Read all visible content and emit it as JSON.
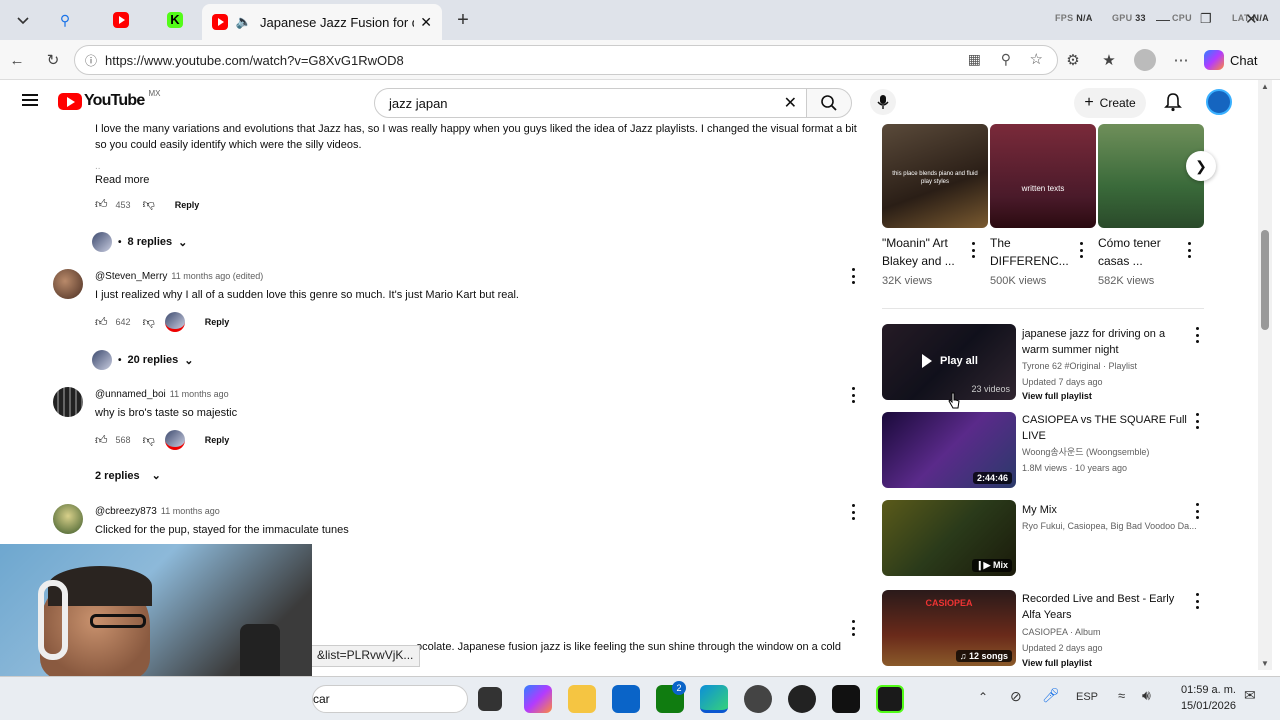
{
  "browser": {
    "active_tab_title": "Japanese Jazz Fusion for drivi",
    "url": "https://www.youtube.com/watch?v=G8XvG1RwOD8",
    "chat_label": "Chat",
    "perf": {
      "fps_label": "FPS",
      "fps_value": "N/A",
      "gpu_label": "GPU",
      "gpu_value": "33",
      "cpu_label": "CPU",
      "lat_label": "LAT",
      "lat_value": "N/A"
    }
  },
  "youtube": {
    "logo": "YouTube",
    "region": "MX",
    "search_value": "jazz japan",
    "create_label": "Create"
  },
  "comments": [
    {
      "text": "I love the many variations and evolutions that Jazz has, so I was really happy when you guys liked the idea of Jazz playlists. I changed the visual format a bit so you could easily identify which were the silly videos.",
      "read_more": "Read more",
      "likes": "453",
      "reply": "Reply",
      "replies": "8 replies"
    },
    {
      "author": "@Steven_Merry",
      "meta": "11 months ago (edited)",
      "text": "I just realized why I all of a sudden love this genre so much. It's just Mario Kart but real.",
      "likes": "642",
      "reply": "Reply",
      "replies": "20 replies"
    },
    {
      "author": "@unnamed_boi",
      "meta": "11 months ago",
      "text": "why is bro's taste so majestic",
      "likes": "568",
      "reply": "Reply",
      "replies": "2 replies"
    },
    {
      "author": "@cbreezy873",
      "meta": "11 months ago",
      "text": "Clicked for the pup, stayed for the immaculate tunes"
    },
    {
      "text": "ocolate. Japanese fusion jazz is like feeling the sun shine through the window on a cold"
    }
  ],
  "status_tooltip": "&list=PLRvwVjK...",
  "shorts": [
    {
      "title_line1": "\"Moanin\" Art",
      "title_line2": "Blakey and ...",
      "views": "32K views",
      "overlay": "this place blends piano and fluid play styles"
    },
    {
      "title_line1": "The",
      "title_line2": "DIFFERENC...",
      "views": "500K views",
      "overlay": "written texts"
    },
    {
      "title_line1": "Cómo tener",
      "title_line2": "casas ...",
      "views": "582K views"
    }
  ],
  "recommendations": [
    {
      "title": "japanese jazz for driving on a warm summer night",
      "meta1": "Tyrone 62 #Original · Playlist",
      "meta2": "Updated 7 days ago",
      "link": "View full playlist",
      "overlay": "Play all",
      "badge": "23 videos"
    },
    {
      "title": "CASIOPEA vs THE SQUARE Full LIVE",
      "meta1": "Woong송사운드 (Woongsemble)",
      "meta2": "1.8M views · 10 years ago",
      "badge": "2:44:46"
    },
    {
      "title": "My Mix",
      "meta1": "Ryo Fukui, Casiopea, Big Bad Voodoo Da...",
      "badge": "Mix"
    },
    {
      "title": "Recorded Live and Best - Early Alfa Years",
      "meta1": "CASIOPEA · Album",
      "meta2": "Updated 2 days ago",
      "link": "View full playlist",
      "badge": "12 songs",
      "thumb_text": "CASIOPEA"
    }
  ],
  "taskbar": {
    "search_fragment": "car",
    "language": "ESP",
    "time": "01:59 a. m.",
    "date": "15/01/2026",
    "xbox_badge": "2"
  },
  "colors": {
    "youtube_red": "#ff0000",
    "accent_blue": "#0b57d0"
  }
}
